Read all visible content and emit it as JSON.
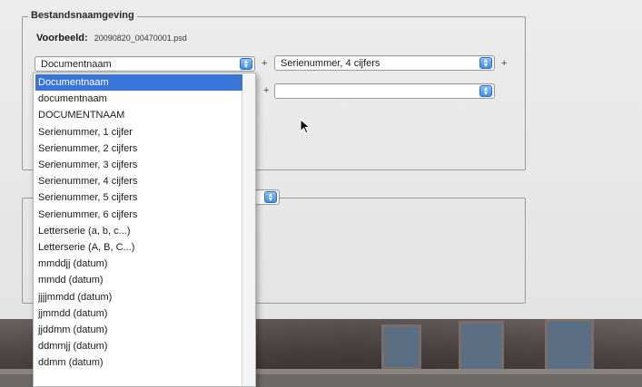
{
  "naming_group": {
    "legend": "Bestandsnaamgeving",
    "example_label": "Voorbeeld:",
    "example_value": "20090820_00470001.psd"
  },
  "row1": {
    "first_select": "Documentnaam",
    "plus1": "+",
    "second_select": "Serienummer, 4 cijfers",
    "plus2": "+"
  },
  "row2": {
    "plus1": "+",
    "second_select": ""
  },
  "dropdown": {
    "selected_index": 0,
    "items": [
      "Documentnaam",
      "documentnaam",
      "DOCUMENTNAAM",
      "Serienummer, 1 cijfer",
      "Serienummer, 2 cijfers",
      "Serienummer, 3 cijfers",
      "Serienummer, 4 cijfers",
      "Serienummer, 5 cijfers",
      "Serienummer, 6 cijfers",
      "Letterserie (a, b, c...)",
      "Letterserie (A, B, C...)",
      "mmddjj (datum)",
      "mmdd (datum)",
      "jjjjmmdd (datum)",
      "jjmmdd (datum)",
      "jjddmm (datum)",
      "ddmmjj (datum)",
      "ddmm (datum)"
    ]
  },
  "icons": {
    "arrow": "up-down-arrows-icon",
    "cursor": "mouse-pointer-icon"
  },
  "colors": {
    "selection": "#3875d7",
    "arrow_button": "#3d8ee6"
  }
}
